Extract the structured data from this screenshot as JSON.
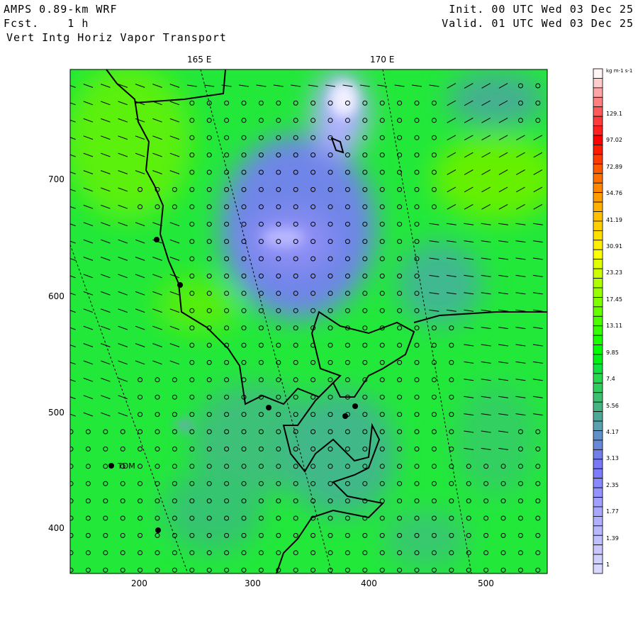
{
  "header": {
    "model": "AMPS 0.89-km WRF",
    "forecast": "Fcst.    1 h",
    "field": "Vert Intg Horiz Vapor Transport",
    "init": "Init. 00 UTC Wed 03 Dec 25",
    "valid": "Valid. 01 UTC Wed 03 Dec 25"
  },
  "map": {
    "lon_labels": [
      "165 E",
      "170 E"
    ],
    "x_ticks": [
      "200",
      "300",
      "400",
      "500"
    ],
    "y_ticks": [
      "700",
      "600",
      "500",
      "400"
    ],
    "x_range": [
      141,
      554
    ],
    "y_range": [
      361,
      795
    ],
    "stations": [
      {
        "label": "TDM"
      }
    ]
  },
  "colorbar": {
    "units": "kg m-1 s-1",
    "labels": [
      "129.1",
      "97.02",
      "72.89",
      "54.76",
      "41.19",
      "30.91",
      "23.23",
      "17.45",
      "13.11",
      "9.85",
      "7.4",
      "5.56",
      "4.17",
      "3.13",
      "2.35",
      "1.77",
      "1.39",
      "1"
    ],
    "colors_top_to_bottom": [
      "#fff5f5",
      "#ffcccc",
      "#ffa5a5",
      "#ff8080",
      "#ff5a5a",
      "#ff3a3a",
      "#ff2020",
      "#ff0000",
      "#ff1a00",
      "#ff3c00",
      "#ff5a00",
      "#ff7000",
      "#ff8800",
      "#ff9c00",
      "#ffb000",
      "#ffc000",
      "#ffd000",
      "#ffe000",
      "#ffef00",
      "#ffff00",
      "#e0ff00",
      "#ccff00",
      "#b0ff00",
      "#99ff00",
      "#80ff00",
      "#66ff00",
      "#4cff00",
      "#33ff00",
      "#1aff00",
      "#00ff00",
      "#00f018",
      "#10e040",
      "#25d850",
      "#30cc60",
      "#3cc070",
      "#45b482",
      "#4da898",
      "#5aa0b0",
      "#6090c8",
      "#6888d8",
      "#7080e8",
      "#7878f8",
      "#7c7cff",
      "#8888ff",
      "#9494ff",
      "#a0a0ff",
      "#a8a8ff",
      "#b0b0ff",
      "#b8b8ff",
      "#c0c0ff",
      "#c8c8ff",
      "#d0d0ff",
      "#d8d8ff"
    ]
  }
}
